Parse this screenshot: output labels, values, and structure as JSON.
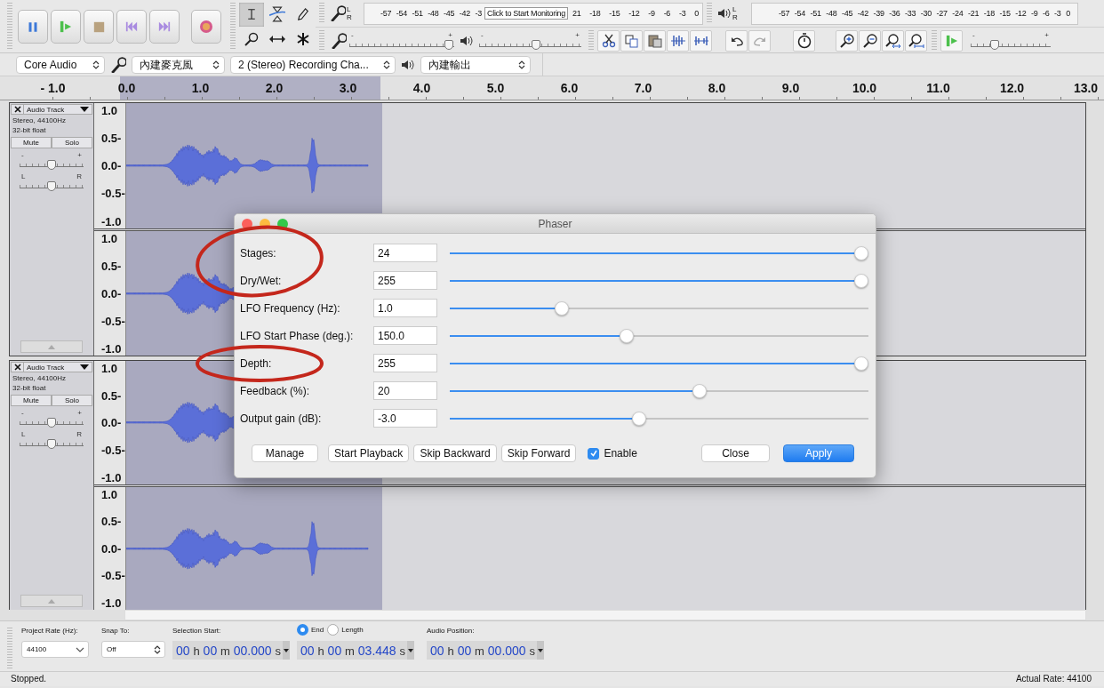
{
  "toolbar": {
    "tools": [
      {
        "kind": "select",
        "selected": true
      },
      {
        "kind": "envelope",
        "selected": false
      },
      {
        "kind": "draw",
        "selected": false
      },
      {
        "kind": "zoom",
        "selected": false
      },
      {
        "kind": "time_shift",
        "selected": false
      },
      {
        "kind": "multi",
        "selected": false
      }
    ],
    "recording_meter": {
      "channels": [
        "L",
        "R"
      ],
      "scale_before": [
        "-57",
        "-54",
        "-51",
        "-48",
        "-45",
        "-42",
        "-3"
      ],
      "tooltip": "Click to Start Monitoring",
      "scale_after": [
        "21",
        "-18",
        "-15",
        "-12",
        "-9",
        "-6",
        "-3",
        "0"
      ]
    },
    "playback_meter": {
      "channels": [
        "L",
        "R"
      ],
      "scale": [
        "-57",
        "-54",
        "-51",
        "-48",
        "-45",
        "-42",
        "-39",
        "-36",
        "-33",
        "-30",
        "-27",
        "-24",
        "-21",
        "-18",
        "-15",
        "-12",
        "-9",
        "-6",
        "-3",
        "0"
      ]
    },
    "recording_volume": {
      "min": "-",
      "max": "+",
      "level": 0.95
    },
    "playback_volume": {
      "min": "-",
      "max": "+",
      "level": 0.56
    },
    "play_at_speed": {
      "min": "-",
      "max": "+",
      "level": 0.3
    }
  },
  "device_bar": {
    "host": "Core Audio",
    "recording_device": "內建麥克風",
    "recording_channels": "2 (Stereo) Recording Cha...",
    "playback_device": "內建輸出"
  },
  "timeline": {
    "labels": [
      "- 1.0",
      "0.0",
      "1.0",
      "2.0",
      "3.0",
      "4.0",
      "5.0",
      "6.0",
      "7.0",
      "8.0",
      "9.0",
      "10.0",
      "11.0",
      "12.0",
      "13.0"
    ]
  },
  "tracks": [
    {
      "name": "Audio Track",
      "format": "Stereo, 44100Hz",
      "sample_format": "32-bit float",
      "mute": "Mute",
      "solo": "Solo",
      "gain": {
        "min": "-",
        "max": "+",
        "level": 0.5
      },
      "pan": {
        "min": "L",
        "max": "R",
        "level": 0.5
      },
      "channels": [
        {
          "scale": [
            "1.0",
            "0.5-",
            "0.0-",
            "-0.5-",
            "-1.0"
          ]
        },
        {
          "scale": [
            "1.0",
            "0.5-",
            "0.0-",
            "-0.5-",
            "-1.0"
          ]
        }
      ]
    },
    {
      "name": "Audio Track",
      "format": "Stereo, 44100Hz",
      "sample_format": "32-bit float",
      "mute": "Mute",
      "solo": "Solo",
      "gain": {
        "min": "-",
        "max": "+",
        "level": 0.5
      },
      "pan": {
        "min": "L",
        "max": "R",
        "level": 0.5
      },
      "channels": [
        {
          "scale": [
            "1.0",
            "0.5-",
            "0.0-",
            "-0.5-",
            "-1.0"
          ]
        },
        {
          "scale": [
            "1.0",
            "0.5-",
            "0.0-",
            "-0.5-",
            "-1.0"
          ]
        }
      ]
    }
  ],
  "dialog": {
    "title": "Phaser",
    "params": [
      {
        "label": "Stages:",
        "value": "24",
        "level": 1.0
      },
      {
        "label": "Dry/Wet:",
        "value": "255",
        "level": 1.0
      },
      {
        "label": "LFO Frequency (Hz):",
        "value": "1.0",
        "level": 0.26
      },
      {
        "label": "LFO Start Phase (deg.):",
        "value": "150.0",
        "level": 0.42
      },
      {
        "label": "Depth:",
        "value": "255",
        "level": 1.0
      },
      {
        "label": "Feedback (%):",
        "value": "20",
        "level": 0.6
      },
      {
        "label": "Output gain (dB):",
        "value": "-3.0",
        "level": 0.45
      }
    ],
    "buttons": [
      "Manage",
      "Start Playback",
      "Skip Backward",
      "Skip Forward"
    ],
    "enable": {
      "label": "Enable",
      "checked": true
    },
    "close": "Close",
    "apply": "Apply"
  },
  "selection_toolbar": {
    "project_rate": {
      "label": "Project Rate (Hz):",
      "value": "44100"
    },
    "snap_to": {
      "label": "Snap To:",
      "value": "Off"
    },
    "selection_start": {
      "label": "Selection Start:",
      "value": "00 h 00 m 00.000 s"
    },
    "mode": [
      {
        "label": "End",
        "selected": true
      },
      {
        "label": "Length",
        "selected": false
      }
    ],
    "selection_end": {
      "value": "00 h 00 m 03.448 s"
    },
    "audio_position": {
      "label": "Audio Position:",
      "value": "00 h 00 m 00.000 s"
    }
  },
  "status_bar": {
    "message": "Stopped.",
    "actual_rate": "Actual Rate: 44100"
  }
}
